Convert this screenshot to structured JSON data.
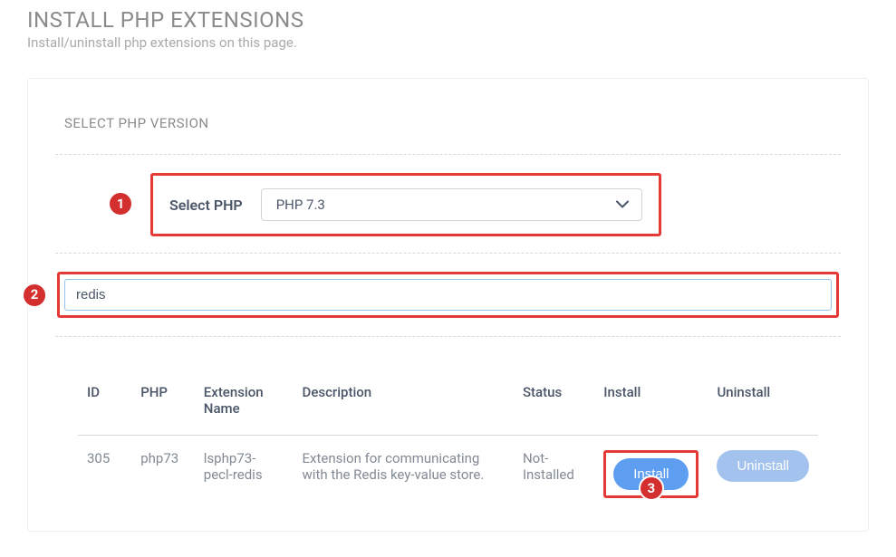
{
  "header": {
    "title": "INSTALL PHP EXTENSIONS",
    "subtitle": "Install/uninstall php extensions on this page."
  },
  "section": {
    "label": "SELECT PHP VERSION"
  },
  "php_select": {
    "label": "Select PHP",
    "selected": "PHP 7.3"
  },
  "search": {
    "value": "redis"
  },
  "annotations": {
    "one": "1",
    "two": "2",
    "three": "3"
  },
  "table": {
    "headers": {
      "id": "ID",
      "php": "PHP",
      "name": "Extension Name",
      "desc": "Description",
      "status": "Status",
      "install": "Install",
      "uninstall": "Uninstall"
    },
    "rows": [
      {
        "id": "305",
        "php": "php73",
        "name": "lsphp73-pecl-redis",
        "desc": "Extension for communicating with the Redis key-value store.",
        "status": "Not-Installed",
        "install_label": "Install",
        "uninstall_label": "Uninstall"
      }
    ]
  },
  "colors": {
    "highlight_red": "#e53935",
    "badge_red": "#d32f2f",
    "btn_primary": "#5e9ef1",
    "btn_secondary": "#a3c3ee"
  }
}
